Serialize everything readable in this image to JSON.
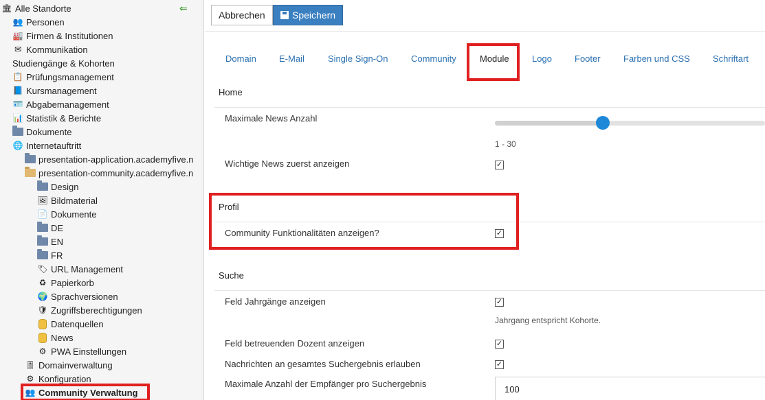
{
  "sidebar": {
    "items": [
      {
        "label": "Alle Standorte",
        "icon": "building-icon",
        "depth": 0,
        "active": false
      },
      {
        "label": "Personen",
        "icon": "people-icon",
        "depth": 1,
        "active": false
      },
      {
        "label": "Firmen & Institutionen",
        "icon": "factory-icon",
        "depth": 1,
        "active": false
      },
      {
        "label": "Kommunikation",
        "icon": "envelope-icon",
        "depth": 1,
        "active": false
      },
      {
        "label": "Studiengänge & Kohorten",
        "icon": "",
        "depth": 1,
        "active": false
      },
      {
        "label": "Prüfungsmanagement",
        "icon": "clipboard-icon",
        "depth": 1,
        "active": false
      },
      {
        "label": "Kursmanagement",
        "icon": "book-icon",
        "depth": 1,
        "active": false
      },
      {
        "label": "Abgabemanagement",
        "icon": "id-card-icon",
        "depth": 1,
        "active": false
      },
      {
        "label": "Statistik & Berichte",
        "icon": "bar-chart-icon",
        "depth": 1,
        "active": false
      },
      {
        "label": "Dokumente",
        "icon": "folder-icon",
        "depth": 1,
        "active": false
      },
      {
        "label": "Internetauftritt",
        "icon": "globe-icon",
        "depth": 1,
        "active": false
      },
      {
        "label": "presentation-application.academyfive.n",
        "icon": "folder-icon",
        "depth": 2,
        "active": false
      },
      {
        "label": "presentation-community.academyfive.n",
        "icon": "folder-open-icon",
        "depth": 2,
        "active": false
      },
      {
        "label": "Design",
        "icon": "folder-icon",
        "depth": 3,
        "active": false
      },
      {
        "label": "Bildmaterial",
        "icon": "image-icon",
        "depth": 3,
        "active": false
      },
      {
        "label": "Dokumente",
        "icon": "documents-icon",
        "depth": 3,
        "active": false
      },
      {
        "label": "DE",
        "icon": "folder-icon",
        "depth": 3,
        "active": false
      },
      {
        "label": "EN",
        "icon": "folder-icon",
        "depth": 3,
        "active": false
      },
      {
        "label": "FR",
        "icon": "folder-icon",
        "depth": 3,
        "active": false
      },
      {
        "label": "URL Management",
        "icon": "tag-icon",
        "depth": 3,
        "active": false
      },
      {
        "label": "Papierkorb",
        "icon": "recycle-icon",
        "depth": 3,
        "active": false
      },
      {
        "label": "Sprachversionen",
        "icon": "globe-color-icon",
        "depth": 3,
        "active": false
      },
      {
        "label": "Zugriffsberechtigungen",
        "icon": "shield-icon",
        "depth": 3,
        "active": false
      },
      {
        "label": "Datenquellen",
        "icon": "database-icon",
        "depth": 3,
        "active": false
      },
      {
        "label": "News",
        "icon": "database-icon",
        "depth": 3,
        "active": false
      },
      {
        "label": "PWA Einstellungen",
        "icon": "gear-icon",
        "depth": 3,
        "active": false
      },
      {
        "label": "Domainverwaltung",
        "icon": "sliders-icon",
        "depth": 2,
        "active": false
      },
      {
        "label": "Konfiguration",
        "icon": "gear-icon",
        "depth": 2,
        "active": false
      },
      {
        "label": "Community Verwaltung",
        "icon": "community-icon",
        "depth": 2,
        "active": true
      }
    ],
    "collapse_icon": "arrow-left-icon"
  },
  "toolbar": {
    "cancel_label": "Abbrechen",
    "save_label": "Speichern",
    "save_icon": "floppy-disk-icon"
  },
  "tabs": [
    {
      "label": "Domain",
      "active": false
    },
    {
      "label": "E-Mail",
      "active": false
    },
    {
      "label": "Single Sign-On",
      "active": false
    },
    {
      "label": "Community",
      "active": false
    },
    {
      "label": "Module",
      "active": true
    },
    {
      "label": "Logo",
      "active": false
    },
    {
      "label": "Footer",
      "active": false
    },
    {
      "label": "Farben und CSS",
      "active": false
    },
    {
      "label": "Schriftart",
      "active": false
    }
  ],
  "sections": {
    "home": {
      "title": "Home",
      "max_news_label": "Maximale News Anzahl",
      "max_news_range": "1 - 30",
      "max_news_value_fraction": 0.4,
      "important_news_label": "Wichtige News zuerst anzeigen",
      "important_news_checked": true
    },
    "profil": {
      "title": "Profil",
      "community_label": "Community Funktionalitäten anzeigen?",
      "community_checked": true
    },
    "suche": {
      "title": "Suche",
      "jahrgaenge_label": "Feld Jahrgänge anzeigen",
      "jahrgaenge_checked": true,
      "jahrgaenge_hint": "Jahrgang entspricht Kohorte.",
      "dozent_label": "Feld betreuenden Dozent anzeigen",
      "dozent_checked": true,
      "nachrichten_label": "Nachrichten an gesamtes Suchergebnis erlauben",
      "nachrichten_checked": true,
      "max_empfaenger_label": "Maximale Anzahl der Empfänger pro Suchergebnis",
      "max_empfaenger_value": "100"
    }
  },
  "check_glyph": "✓",
  "colors": {
    "highlight": "#e02020",
    "link": "#2a6fb0",
    "primary_button": "#3a7fc0",
    "slider_knob": "#1e88d8"
  }
}
